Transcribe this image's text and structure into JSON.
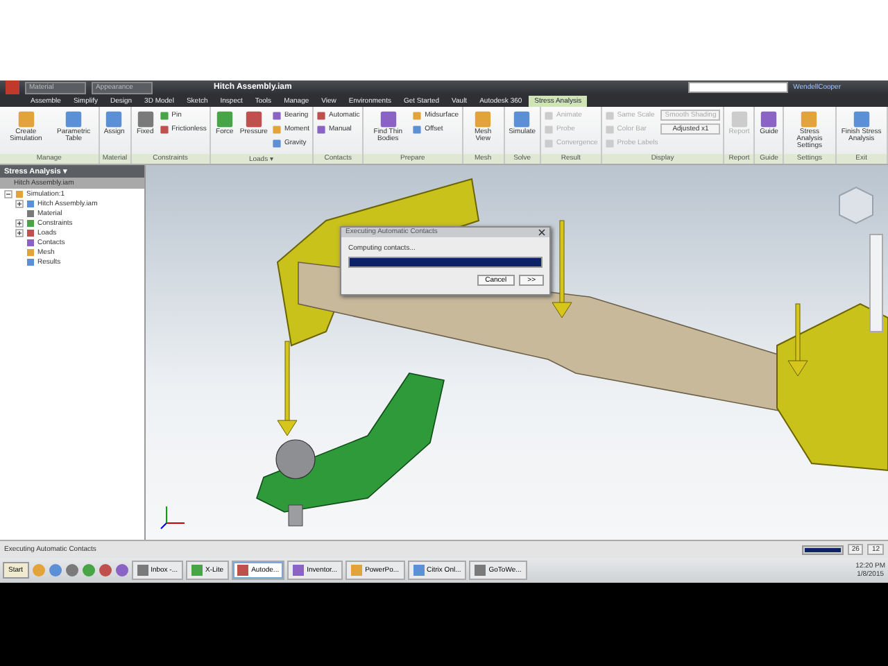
{
  "title_bar": {
    "title": "Hitch Assembly.iam",
    "material_placeholder": "Material",
    "appearance_placeholder": "Appearance",
    "user": "WendellCooper"
  },
  "menu_tabs": [
    {
      "label": "Assemble",
      "selected": false
    },
    {
      "label": "Simplify",
      "selected": false
    },
    {
      "label": "Design",
      "selected": false
    },
    {
      "label": "3D Model",
      "selected": false
    },
    {
      "label": "Sketch",
      "selected": false
    },
    {
      "label": "Inspect",
      "selected": false
    },
    {
      "label": "Tools",
      "selected": false
    },
    {
      "label": "Manage",
      "selected": false
    },
    {
      "label": "View",
      "selected": false
    },
    {
      "label": "Environments",
      "selected": false
    },
    {
      "label": "Get Started",
      "selected": false
    },
    {
      "label": "Vault",
      "selected": false
    },
    {
      "label": "Autodesk 360",
      "selected": false
    },
    {
      "label": "Stress Analysis",
      "selected": true
    }
  ],
  "ribbon": [
    {
      "label": "Manage",
      "items": [
        {
          "kind": "large",
          "label": "Create Simulation",
          "disabled": false
        },
        {
          "kind": "large",
          "label": "Parametric Table",
          "disabled": false
        }
      ]
    },
    {
      "label": "Material",
      "items": [
        {
          "kind": "large",
          "label": "Assign",
          "disabled": false
        }
      ]
    },
    {
      "label": "Constraints",
      "items": [
        {
          "kind": "large",
          "label": "Fixed",
          "disabled": false
        },
        {
          "kind": "small",
          "label": "Pin",
          "disabled": false
        },
        {
          "kind": "small",
          "label": "Frictionless",
          "disabled": false
        }
      ]
    },
    {
      "label": "Loads ▾",
      "items": [
        {
          "kind": "large",
          "label": "Force",
          "disabled": false
        },
        {
          "kind": "large",
          "label": "Pressure",
          "disabled": false
        },
        {
          "kind": "small",
          "label": "Bearing",
          "disabled": false
        },
        {
          "kind": "small",
          "label": "Moment",
          "disabled": false
        },
        {
          "kind": "small",
          "label": "Gravity",
          "disabled": false
        }
      ]
    },
    {
      "label": "Contacts",
      "items": [
        {
          "kind": "small",
          "label": "Automatic",
          "disabled": false
        },
        {
          "kind": "small",
          "label": "Manual",
          "disabled": false
        }
      ]
    },
    {
      "label": "Prepare",
      "items": [
        {
          "kind": "large",
          "label": "Find Thin Bodies",
          "disabled": false
        },
        {
          "kind": "small",
          "label": "Midsurface",
          "disabled": false
        },
        {
          "kind": "small",
          "label": "Offset",
          "disabled": false
        }
      ]
    },
    {
      "label": "Mesh",
      "items": [
        {
          "kind": "large",
          "label": "Mesh View",
          "disabled": false
        }
      ]
    },
    {
      "label": "Solve",
      "items": [
        {
          "kind": "large",
          "label": "Simulate",
          "disabled": false
        }
      ]
    },
    {
      "label": "Result",
      "items": [
        {
          "kind": "small",
          "label": "Animate",
          "disabled": true
        },
        {
          "kind": "small",
          "label": "Probe",
          "disabled": true
        },
        {
          "kind": "small",
          "label": "Convergence",
          "disabled": true
        }
      ]
    },
    {
      "label": "Display",
      "items": [
        {
          "kind": "small",
          "label": "Same Scale",
          "disabled": true
        },
        {
          "kind": "small",
          "label": "Color Bar",
          "disabled": true
        },
        {
          "kind": "small",
          "label": "Probe Labels",
          "disabled": true
        },
        {
          "kind": "dropdown",
          "label": "Smooth Shading",
          "disabled": true
        },
        {
          "kind": "dropdown",
          "label": "Adjusted x1",
          "disabled": false
        }
      ]
    },
    {
      "label": "Report",
      "items": [
        {
          "kind": "large",
          "label": "Report",
          "disabled": true
        }
      ]
    },
    {
      "label": "Guide",
      "items": [
        {
          "kind": "large",
          "label": "Guide",
          "disabled": false
        }
      ]
    },
    {
      "label": "Settings",
      "items": [
        {
          "kind": "large",
          "label": "Stress Analysis Settings",
          "disabled": false
        }
      ]
    },
    {
      "label": "Exit",
      "items": [
        {
          "kind": "large",
          "label": "Finish Stress Analysis",
          "disabled": false
        }
      ]
    }
  ],
  "browser": {
    "title": "Stress Analysis ▾",
    "root": {
      "label": "Hitch Assembly.iam",
      "selected": true
    },
    "tree": [
      {
        "label": "Simulation:1",
        "selected": false,
        "expanded": true,
        "children": [
          {
            "label": "Hitch Assembly.iam",
            "selected": false,
            "expanded": false
          },
          {
            "label": "Material",
            "selected": false
          },
          {
            "label": "Constraints",
            "selected": false,
            "expanded": false
          },
          {
            "label": "Loads",
            "selected": false,
            "expanded": false
          },
          {
            "label": "Contacts",
            "selected": false
          },
          {
            "label": "Mesh",
            "selected": false
          },
          {
            "label": "Results",
            "selected": false
          }
        ]
      }
    ]
  },
  "dialog": {
    "title": "Executing Automatic Contacts",
    "message": "Computing contacts...",
    "level": 1,
    "cancel": "Cancel",
    "more": ">>"
  },
  "status_bar": {
    "message": "Executing Automatic Contacts",
    "level": 1,
    "count_1": "26",
    "count_2": "12"
  },
  "taskbar": {
    "start": "Start",
    "windows": [
      {
        "label": "Inbox -...",
        "selected": false
      },
      {
        "label": "X-Lite",
        "selected": false
      },
      {
        "label": "Autode...",
        "selected": true
      },
      {
        "label": "Inventor...",
        "selected": false
      },
      {
        "label": "PowerPo...",
        "selected": false
      },
      {
        "label": "Citrix Onl...",
        "selected": false
      },
      {
        "label": "GoToWe...",
        "selected": false
      }
    ],
    "time": "12:20 PM",
    "date": "1/8/2015"
  }
}
